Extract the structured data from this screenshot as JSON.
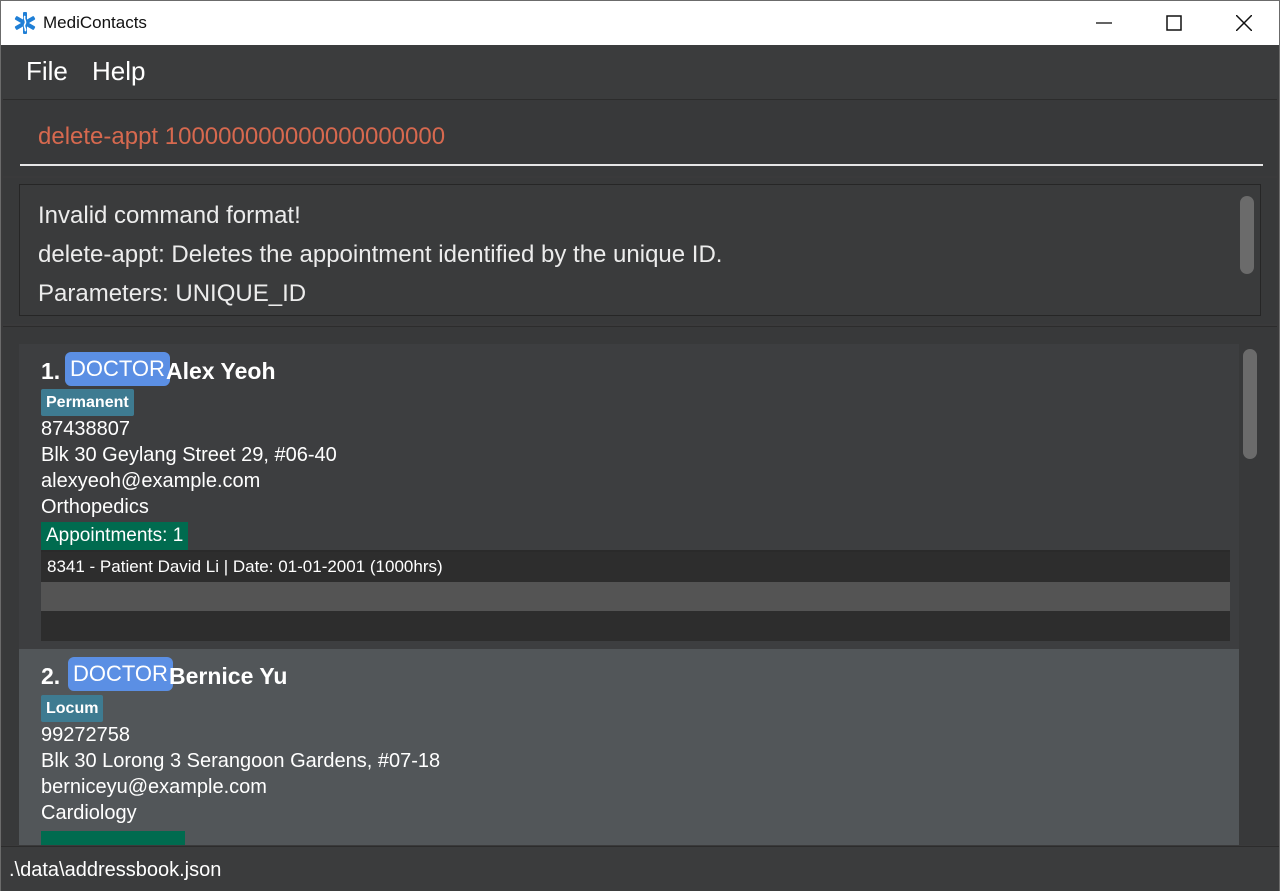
{
  "window": {
    "title": "MediContacts",
    "icon": "medical-star-icon"
  },
  "menu": {
    "items": [
      {
        "label": "File"
      },
      {
        "label": "Help"
      }
    ]
  },
  "command": {
    "value": "delete-appt 100000000000000000000",
    "text_color": "#d7694f"
  },
  "result": {
    "lines": [
      "Invalid command format!",
      "delete-appt: Deletes the appointment identified by the unique ID.",
      "Parameters: UNIQUE_ID"
    ]
  },
  "persons": [
    {
      "index": "1.",
      "role": "DOCTOR",
      "name": "Alex Yeoh",
      "tag": "Permanent",
      "phone": "87438807",
      "address": "Blk 30 Geylang Street 29, #06-40",
      "email": "alexyeoh@example.com",
      "specialty": "Orthopedics",
      "appointments_label": "Appointments: 1",
      "appointments": [
        "8341 - Patient David Li | Date: 01-01-2001 (1000hrs)"
      ]
    },
    {
      "index": "2.",
      "role": "DOCTOR",
      "name": "Bernice Yu",
      "tag": "Locum",
      "phone": "99272758",
      "address": "Blk 30 Lorong 3 Serangoon Gardens, #07-18",
      "email": "berniceyu@example.com",
      "specialty": "Cardiology"
    }
  ],
  "status": {
    "file_path": ".\\data\\addressbook.json"
  },
  "colors": {
    "role_badge": "#5b8fe4",
    "tag": "#3e7b91",
    "appointments_badge": "#006b4f",
    "selected_card": "#525659"
  }
}
